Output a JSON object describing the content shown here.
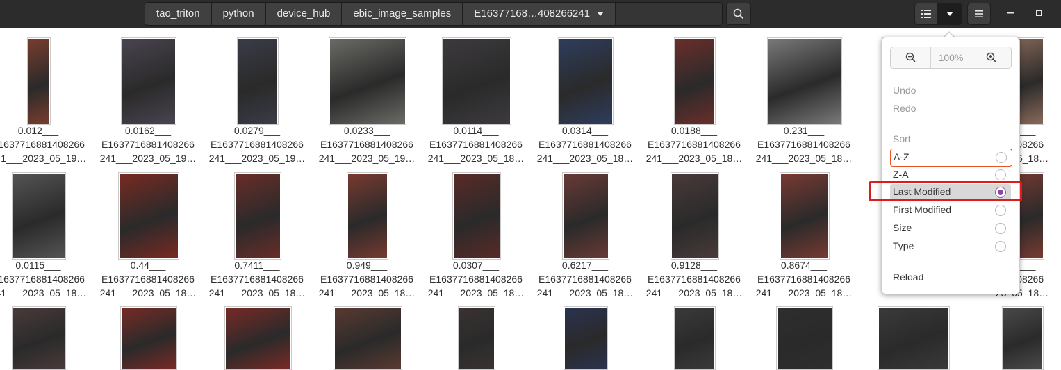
{
  "header": {
    "breadcrumbs": [
      "tao_triton",
      "python",
      "device_hub",
      "ebic_image_samples",
      "E16377168…408266241"
    ]
  },
  "grid": {
    "row1": [
      {
        "line1": "0.012___",
        "line2": "E1637716881408266",
        "line3": "241___2023_05_19…"
      },
      {
        "line1": "0.0162___",
        "line2": "E1637716881408266",
        "line3": "241___2023_05_19…"
      },
      {
        "line1": "0.0279___",
        "line2": "E1637716881408266",
        "line3": "241___2023_05_19…"
      },
      {
        "line1": "0.0233___",
        "line2": "E1637716881408266",
        "line3": "241___2023_05_19…"
      },
      {
        "line1": "0.0114___",
        "line2": "E1637716881408266",
        "line3": "241___2023_05_18…"
      },
      {
        "line1": "0.0314___",
        "line2": "E1637716881408266",
        "line3": "241___2023_05_18…"
      },
      {
        "line1": "0.0188___",
        "line2": "E1637716881408266",
        "line3": "241___2023_05_18…"
      },
      {
        "line1": "0.231___",
        "line2": "E1637716881408266",
        "line3": "241___2023_05_18…"
      },
      {
        "line1": "",
        "line2": "E16",
        "line3": ""
      },
      {
        "line1": "35___",
        "line2": "81408266",
        "line3": "23_05_18…"
      }
    ],
    "row2": [
      {
        "line1": "0.0115___",
        "line2": "E1637716881408266",
        "line3": "241___2023_05_18…"
      },
      {
        "line1": "0.44___",
        "line2": "E1637716881408266",
        "line3": "241___2023_05_18…"
      },
      {
        "line1": "0.7411___",
        "line2": "E1637716881408266",
        "line3": "241___2023_05_18…"
      },
      {
        "line1": "0.949___",
        "line2": "E1637716881408266",
        "line3": "241___2023_05_18…"
      },
      {
        "line1": "0.0307___",
        "line2": "E1637716881408266",
        "line3": "241___2023_05_18…"
      },
      {
        "line1": "0.6217___",
        "line2": "E1637716881408266",
        "line3": "241___2023_05_18…"
      },
      {
        "line1": "0.9128___",
        "line2": "E1637716881408266",
        "line3": "241___2023_05_18…"
      },
      {
        "line1": "0.8674___",
        "line2": "E1637716881408266",
        "line3": "241___2023_05_18…"
      },
      {
        "line1": "",
        "line2": "E16",
        "line3": ""
      },
      {
        "line1": "17___",
        "line2": "81408266",
        "line3": "23_05_18…"
      }
    ]
  },
  "popover": {
    "zoom_value": "100%",
    "undo": "Undo",
    "redo": "Redo",
    "sort_heading": "Sort",
    "sort_options": [
      "A-Z",
      "Z-A",
      "Last Modified",
      "First Modified",
      "Size",
      "Type"
    ],
    "selected_sort": "Last Modified",
    "reload": "Reload"
  },
  "colors": {
    "header_bg": "#2c2c2c",
    "accent_focus": "#e95420",
    "radio_selected": "#8e44ad",
    "annotation_box": "#e01b1b"
  }
}
